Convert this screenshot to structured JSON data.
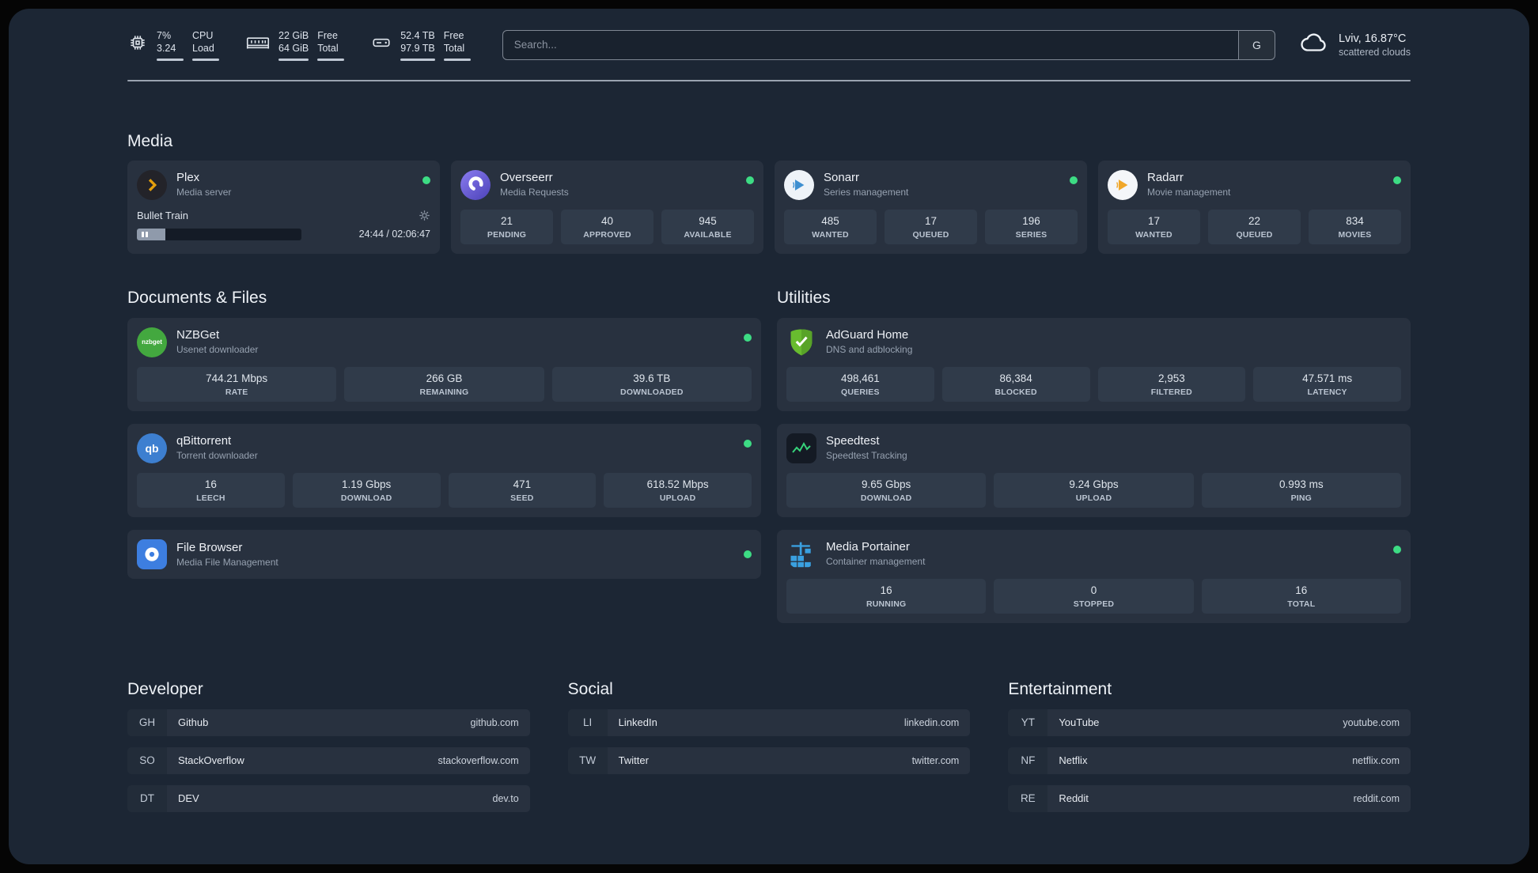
{
  "topbar": {
    "cpu": {
      "icon": "cpu-chip-icon",
      "value1": "7%",
      "value2": "3.24",
      "label1": "CPU",
      "label2": "Load"
    },
    "memory": {
      "icon": "ram-icon",
      "value1": "22 GiB",
      "value2": "64 GiB",
      "label1": "Free",
      "label2": "Total"
    },
    "disk": {
      "icon": "hard-drive-icon",
      "value1": "52.4 TB",
      "value2": "97.9 TB",
      "label1": "Free",
      "label2": "Total"
    },
    "search": {
      "placeholder": "Search...",
      "button_label": "G"
    },
    "weather": {
      "icon": "cloud-icon",
      "location": "Lviv, 16.87°C",
      "condition": "scattered clouds"
    }
  },
  "media": {
    "title": "Media",
    "plex": {
      "icon": "plex-chevron-icon",
      "name": "Plex",
      "desc": "Media server",
      "now_playing": "Bullet Train",
      "time": "24:44 / 02:06:47"
    },
    "overseerr": {
      "icon": "overseerr-ring-icon",
      "name": "Overseerr",
      "desc": "Media Requests",
      "stats": [
        {
          "value": "21",
          "label": "PENDING"
        },
        {
          "value": "40",
          "label": "APPROVED"
        },
        {
          "value": "945",
          "label": "AVAILABLE"
        }
      ]
    },
    "sonarr": {
      "icon": "sonarr-play-icon",
      "name": "Sonarr",
      "desc": "Series management",
      "stats": [
        {
          "value": "485",
          "label": "WANTED"
        },
        {
          "value": "17",
          "label": "QUEUED"
        },
        {
          "value": "196",
          "label": "SERIES"
        }
      ]
    },
    "radarr": {
      "icon": "radarr-play-icon",
      "name": "Radarr",
      "desc": "Movie management",
      "stats": [
        {
          "value": "17",
          "label": "WANTED"
        },
        {
          "value": "22",
          "label": "QUEUED"
        },
        {
          "value": "834",
          "label": "MOVIES"
        }
      ]
    }
  },
  "documents": {
    "title": "Documents & Files",
    "nzbget": {
      "icon": "nzbget-icon",
      "icon_text": "nzbget",
      "name": "NZBGet",
      "desc": "Usenet downloader",
      "stats": [
        {
          "value": "744.21 Mbps",
          "label": "RATE"
        },
        {
          "value": "266 GB",
          "label": "REMAINING"
        },
        {
          "value": "39.6 TB",
          "label": "DOWNLOADED"
        }
      ]
    },
    "qbittorrent": {
      "icon": "qbittorrent-icon",
      "icon_text": "qb",
      "name": "qBittorrent",
      "desc": "Torrent downloader",
      "stats": [
        {
          "value": "16",
          "label": "LEECH"
        },
        {
          "value": "1.19 Gbps",
          "label": "DOWNLOAD"
        },
        {
          "value": "471",
          "label": "SEED"
        },
        {
          "value": "618.52 Mbps",
          "label": "UPLOAD"
        }
      ]
    },
    "filebrowser": {
      "icon": "filebrowser-icon",
      "name": "File Browser",
      "desc": "Media File Management"
    }
  },
  "utilities": {
    "title": "Utilities",
    "adguard": {
      "icon": "adguard-shield-icon",
      "name": "AdGuard Home",
      "desc": "DNS and adblocking",
      "stats": [
        {
          "value": "498,461",
          "label": "QUERIES"
        },
        {
          "value": "86,384",
          "label": "BLOCKED"
        },
        {
          "value": "2,953",
          "label": "FILTERED"
        },
        {
          "value": "47.571 ms",
          "label": "LATENCY"
        }
      ]
    },
    "speedtest": {
      "icon": "speedtest-graph-icon",
      "name": "Speedtest",
      "desc": "Speedtest Tracking",
      "stats": [
        {
          "value": "9.65 Gbps",
          "label": "DOWNLOAD"
        },
        {
          "value": "9.24 Gbps",
          "label": "UPLOAD"
        },
        {
          "value": "0.993 ms",
          "label": "PING"
        }
      ]
    },
    "portainer": {
      "icon": "portainer-crane-icon",
      "name": "Media Portainer",
      "desc": "Container management",
      "stats": [
        {
          "value": "16",
          "label": "RUNNING"
        },
        {
          "value": "0",
          "label": "STOPPED"
        },
        {
          "value": "16",
          "label": "TOTAL"
        }
      ]
    }
  },
  "bookmarks": {
    "developer": {
      "title": "Developer",
      "items": [
        {
          "abbr": "GH",
          "name": "Github",
          "domain": "github.com"
        },
        {
          "abbr": "SO",
          "name": "StackOverflow",
          "domain": "stackoverflow.com"
        },
        {
          "abbr": "DT",
          "name": "DEV",
          "domain": "dev.to"
        }
      ]
    },
    "social": {
      "title": "Social",
      "items": [
        {
          "abbr": "LI",
          "name": "LinkedIn",
          "domain": "linkedin.com"
        },
        {
          "abbr": "TW",
          "name": "Twitter",
          "domain": "twitter.com"
        }
      ]
    },
    "entertainment": {
      "title": "Entertainment",
      "items": [
        {
          "abbr": "YT",
          "name": "YouTube",
          "domain": "youtube.com"
        },
        {
          "abbr": "NF",
          "name": "Netflix",
          "domain": "netflix.com"
        },
        {
          "abbr": "RE",
          "name": "Reddit",
          "domain": "reddit.com"
        }
      ]
    }
  },
  "colors": {
    "background": "#1c2634",
    "card": "#28313f",
    "tile": "#303b4a",
    "status_online": "#3ddc84",
    "plex_accent": "#e5a00d",
    "overseerr_purple": "#6d5ce8",
    "sonarr_blue": "#3e8fd0",
    "radarr_amber": "#f0a72a",
    "nzbget_green": "#43a83f",
    "qbittorrent_blue": "#3d7fd0",
    "filebrowser_blue": "#3d7ee0",
    "adguard_green": "#68bc2f",
    "speedtest_green": "#36d27a",
    "portainer_blue": "#3aa0e0"
  }
}
